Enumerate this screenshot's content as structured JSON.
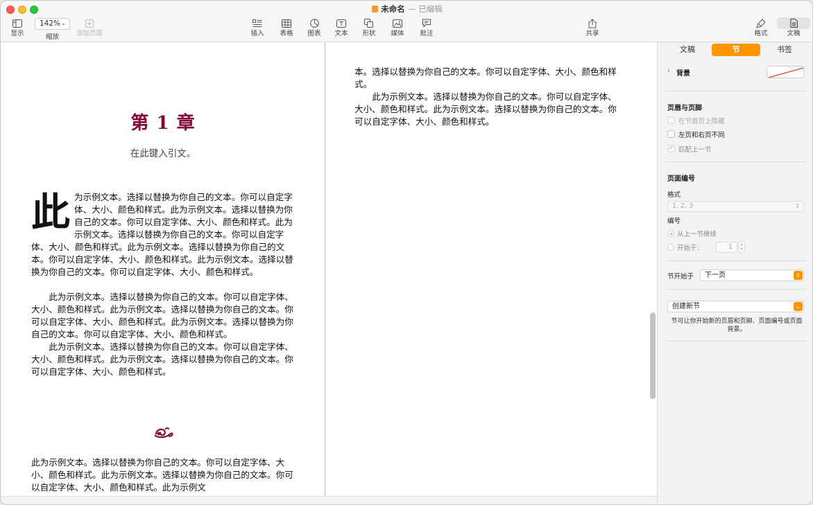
{
  "window": {
    "title": "未命名",
    "separator": "—",
    "status": "已编辑"
  },
  "toolbar": {
    "view": "显示",
    "zoom_value": "142%",
    "zoom": "缩放",
    "add_page": "添加页面",
    "insert": "插入",
    "table": "表格",
    "chart": "图表",
    "text": "文本",
    "shape": "形状",
    "media": "媒体",
    "comment": "批注",
    "share": "共享",
    "format": "格式",
    "document": "文稿"
  },
  "document": {
    "chapter_title": "第 1 章",
    "chapter_subtitle": "在此键入引文。",
    "drop_cap": "此",
    "drop_cap_para": "为示例文本。选择以替换为你自己的文本。你可以自定字体、大小、颜色和样式。此为示例文本。选择以替换为你自己的文本。你可以自定字体、大小、颜色和样式。此为示例文本。选择以替换为你自己的文本。你可以自定字体、大小、颜色和样式。此为示例文本。选择以替换为你自己的文本。你可以自定字体、大小、颜色和样式。此为示例文本。选择以替换为你自己的文本。你可以自定字体、大小、颜色和样式。",
    "para_2": "此为示例文本。选择以替换为你自己的文本。你可以自定字体、大小、颜色和样式。此为示例文本。选择以替换为你自己的文本。你可以自定字体、大小、颜色和样式。此为示例文本。选择以替换为你自己的文本。你可以自定字体、大小、颜色和样式。",
    "para_3": "此为示例文本。选择以替换为你自己的文本。你可以自定字体、大小、颜色和样式。此为示例文本。选择以替换为你自己的文本。你可以自定字体、大小、颜色和样式。",
    "bottom_para": "此为示例文本。选择以替换为你自己的文本。你可以自定字体、大小、颜色和样式。此为示例文本。选择以替换为你自己的文本。你可以自定字体、大小、颜色和样式。此为示例文",
    "right_para_1": "本。选择以替换为你自己的文本。你可以自定字体、大小、颜色和样式。",
    "right_para_2": "此为示例文本。选择以替换为你自己的文本。你可以自定字体、大小、颜色和样式。此为示例文本。选择以替换为你自己的文本。你可以自定字体、大小、颜色和样式。"
  },
  "inspector": {
    "tabs": [
      "文稿",
      "节",
      "书签"
    ],
    "active_tab": "节",
    "background_label": "背景",
    "header_footer_heading": "页眉与页脚",
    "hide_on_first_page": "在节首页上隐藏",
    "left_right_different": "左页和右页不同",
    "match_previous": "匹配上一节",
    "page_numbering_heading": "页面编号",
    "format_label": "格式",
    "format_value": "1, 2, 3",
    "numbering_label": "编号",
    "continue_from_previous": "从上一节继续",
    "start_at_label": "开始于：",
    "start_at_value": "1",
    "section_starts_on_label": "节开始于",
    "section_starts_on_value": "下一页",
    "create_new_section": "创建新节",
    "new_section_help": "节可让你开始新的页眉和页脚、页面编号或页面背景。"
  },
  "colors": {
    "accent": "#ff9500",
    "chapter_title": "#800a3a"
  }
}
